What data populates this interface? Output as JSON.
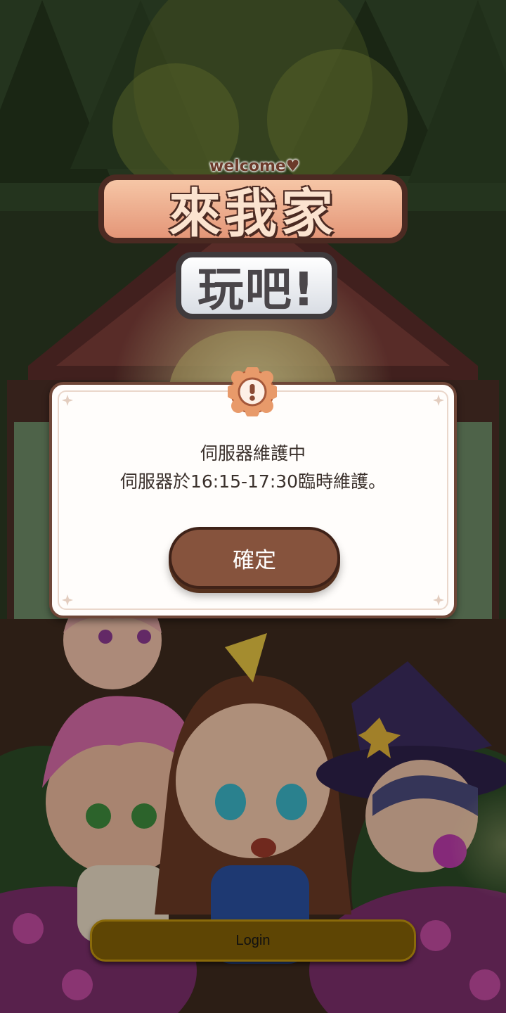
{
  "logo": {
    "welcome": "welcome♥",
    "line1": "來我家",
    "line2": "玩吧!"
  },
  "dialog": {
    "badge_icon": "exclamation-icon",
    "title": "伺服器維護中",
    "message": "伺服器於16:15-17:30臨時維護。",
    "confirm_label": "確定"
  },
  "login": {
    "label": "Login"
  },
  "colors": {
    "dialog_border": "#6e4637",
    "confirm_button": "#86533d",
    "login_button": "#5e4504",
    "badge": "#e89a6a"
  }
}
